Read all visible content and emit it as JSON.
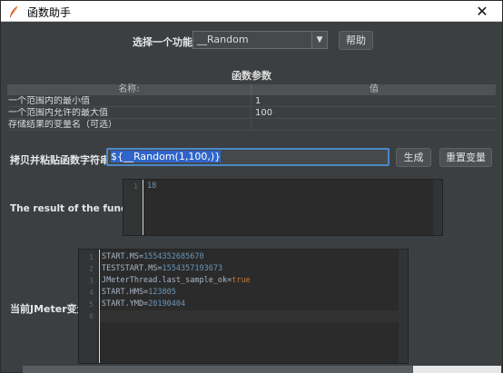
{
  "window": {
    "title": "函数助手",
    "close_glyph": "✕",
    "icon": "feather-icon"
  },
  "function_select": {
    "label": "选择一个功能",
    "value": "__Random",
    "help_button": "帮助"
  },
  "params": {
    "title": "函数参数",
    "columns": [
      "名称:",
      "值"
    ],
    "rows": [
      {
        "name": "一个范围内的最小值",
        "value": "1"
      },
      {
        "name": "一个范围内允许的最大值",
        "value": "100"
      },
      {
        "name": "存储结果的变量名（可选）",
        "value": ""
      }
    ]
  },
  "copy": {
    "label": "拷贝并粘贴函数字符串",
    "value": "${__Random(1,100,)}",
    "generate_button": "生成",
    "reset_button": "重置变量"
  },
  "result": {
    "label": "The result of the function is",
    "lines": [
      "18"
    ]
  },
  "vars": {
    "label": "当前JMeter变量",
    "line_numbers": [
      "1",
      "2",
      "3",
      "4",
      "5",
      "6"
    ],
    "lines": [
      {
        "key": "START.MS=",
        "val": "1554352685670",
        "type": "num"
      },
      {
        "key": "TESTSTART.MS=",
        "val": "1554357193673",
        "type": "num"
      },
      {
        "key": "JMeterThread.last_sample_ok=",
        "val": "true",
        "type": "kw"
      },
      {
        "key": "START.HMS=",
        "val": "123805",
        "type": "num"
      },
      {
        "key": "START.YMD=",
        "val": "20190404",
        "type": "num"
      },
      {
        "key": "",
        "val": "",
        "type": "none"
      }
    ]
  },
  "colors": {
    "background": "#3c3f41",
    "accent_border": "#4a88c7",
    "number": "#6897bb",
    "keyword": "#cc7832"
  }
}
